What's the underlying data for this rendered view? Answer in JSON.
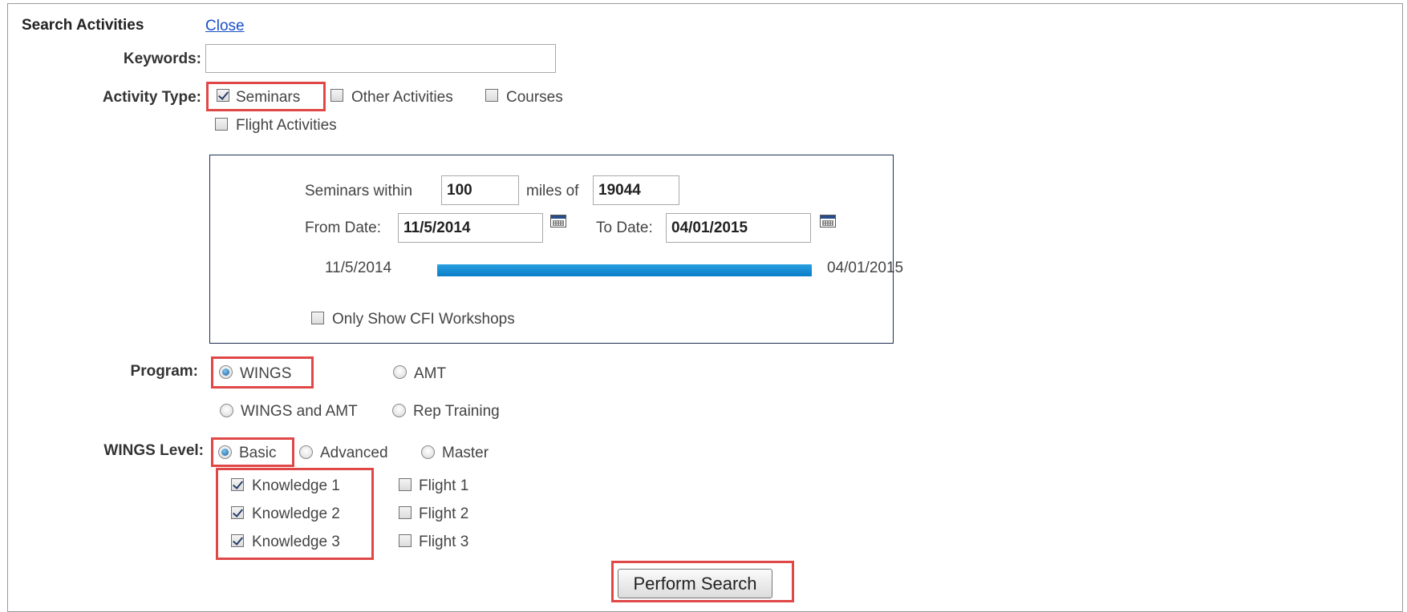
{
  "header": {
    "title": "Search Activities",
    "close_link": "Close"
  },
  "keywords": {
    "label": "Keywords:",
    "value": "",
    "placeholder": ""
  },
  "activity_type": {
    "label": "Activity Type:",
    "options": [
      {
        "label": "Seminars",
        "checked": true
      },
      {
        "label": "Other Activities",
        "checked": false
      },
      {
        "label": "Courses",
        "checked": false
      },
      {
        "label": "Flight Activities",
        "checked": false
      }
    ]
  },
  "seminar_filter": {
    "within_label": "Seminars within",
    "distance": "100",
    "miles_label": "miles of",
    "zip": "19044",
    "from_label": "From Date:",
    "from_date": "11/5/2014",
    "to_label": "To Date:",
    "to_date": "04/01/2015",
    "range_start": "11/5/2014",
    "range_end": "04/01/2015",
    "cfi_label": "Only Show CFI Workshops",
    "cfi_checked": false
  },
  "program": {
    "label": "Program:",
    "options": [
      {
        "label": "WINGS",
        "selected": true
      },
      {
        "label": "AMT",
        "selected": false
      },
      {
        "label": "WINGS and AMT",
        "selected": false
      },
      {
        "label": "Rep Training",
        "selected": false
      }
    ]
  },
  "wings_level": {
    "label": "WINGS Level:",
    "options": [
      {
        "label": "Basic",
        "selected": true
      },
      {
        "label": "Advanced",
        "selected": false
      },
      {
        "label": "Master",
        "selected": false
      }
    ],
    "knowledge": [
      {
        "label": "Knowledge 1",
        "checked": true
      },
      {
        "label": "Knowledge 2",
        "checked": true
      },
      {
        "label": "Knowledge 3",
        "checked": true
      }
    ],
    "flight": [
      {
        "label": "Flight 1",
        "checked": false
      },
      {
        "label": "Flight 2",
        "checked": false
      },
      {
        "label": "Flight 3",
        "checked": false
      }
    ]
  },
  "actions": {
    "search_label": "Perform Search"
  },
  "colors": {
    "highlight": "#e04848",
    "link": "#1a50c8",
    "slider": "#0a7cc8",
    "panel_border": "#1e2f55"
  }
}
